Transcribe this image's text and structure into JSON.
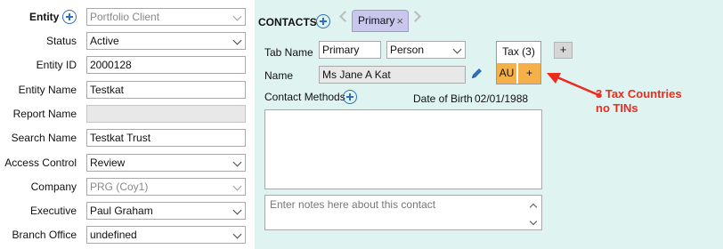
{
  "entity_form": {
    "title": "Entity",
    "fields": [
      {
        "label": "Status",
        "value": "Active",
        "type": "select"
      },
      {
        "label": "Entity ID",
        "value": "2000128",
        "type": "text"
      },
      {
        "label": "Entity Name",
        "value": "Testkat",
        "type": "text"
      },
      {
        "label": "Report Name",
        "value": "",
        "type": "text",
        "disabled": true
      },
      {
        "label": "Search Name",
        "value": "Testkat Trust",
        "type": "text"
      },
      {
        "label": "Access Control",
        "value": "Review",
        "type": "select"
      },
      {
        "label": "Company",
        "value": "PRG (Coy1)",
        "type": "select",
        "disabled": true
      },
      {
        "label": "Executive",
        "value": "Paul Graham",
        "type": "select"
      },
      {
        "label": "Branch Office",
        "value": "undefined",
        "type": "select"
      }
    ],
    "entity_type": {
      "value": "Portfolio Client",
      "disabled": true
    }
  },
  "contacts": {
    "title": "CONTACTS",
    "tabs": [
      {
        "label": "Primary",
        "close": "×",
        "active": true
      }
    ],
    "tab_name_label": "Tab Name",
    "tab_name_value": "Primary",
    "contact_type": "Person",
    "name_label": "Name",
    "name_value": "Ms  Jane A Kat",
    "contact_methods_label": "Contact Methods",
    "dob_label": "Date of Birth",
    "dob_value": "02/01/1988",
    "tax": {
      "header": "Tax (3)",
      "cells": [
        "AU",
        "+"
      ]
    },
    "add_tax_button": "+",
    "notes_placeholder": "Enter notes here about this contact"
  },
  "annotation": {
    "text": "3 Tax Countries\nno TINs",
    "color": "#ee2a1f"
  },
  "colors": {
    "panel_bg": "#dff3f1",
    "tab_active": "#c9c7ec",
    "tax_cell": "#f6b048",
    "accent_blue": "#2f6fb7"
  }
}
